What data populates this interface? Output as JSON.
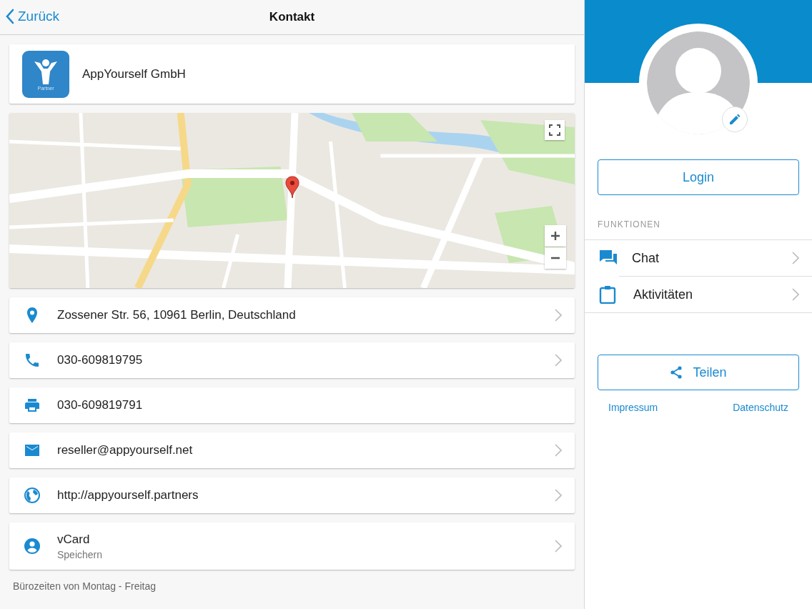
{
  "header": {
    "back": "Zurück",
    "title": "Kontakt"
  },
  "company": {
    "name": "AppYourself GmbH",
    "logo_label": "Partner"
  },
  "contacts": [
    {
      "kind": "address",
      "text": "Zossener Str. 56, 10961 Berlin, Deutschland",
      "linked": true
    },
    {
      "kind": "phone",
      "text": "030-609819795",
      "linked": true
    },
    {
      "kind": "fax",
      "text": "030-609819791",
      "linked": false
    },
    {
      "kind": "email",
      "text": "reseller@appyourself.net",
      "linked": true
    },
    {
      "kind": "web",
      "text": "http://appyourself.partners",
      "linked": true
    },
    {
      "kind": "vcard",
      "text": "vCard",
      "subtext": "Speichern",
      "linked": true
    }
  ],
  "footer_note": "Bürozeiten von Montag - Freitag",
  "sidebar": {
    "login": "Login",
    "section": "FUNKTIONEN",
    "items": [
      {
        "kind": "chat",
        "label": "Chat"
      },
      {
        "kind": "activities",
        "label": "Aktivitäten"
      }
    ],
    "share": "Teilen",
    "links": [
      "Impressum",
      "Datenschutz"
    ]
  }
}
